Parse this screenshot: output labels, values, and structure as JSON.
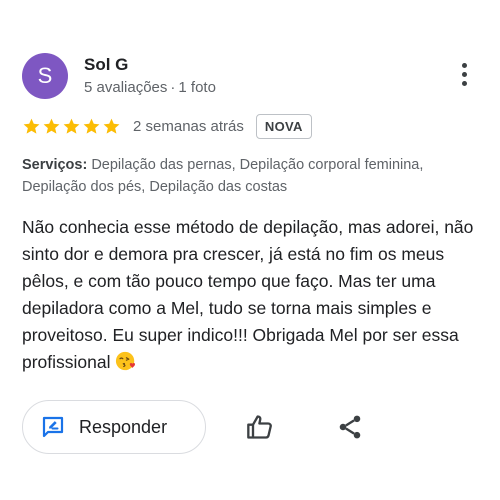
{
  "reviewer": {
    "initial": "S",
    "name": "Sol G",
    "reviews_count": "5 avaliações",
    "separator": "·",
    "photos_count": "1 foto",
    "avatar_color": "#7e57c2"
  },
  "rating": {
    "stars": 5,
    "max_stars": 5,
    "star_color": "#fbbc04",
    "time_ago": "2 semanas atrás",
    "badge": "NOVA"
  },
  "services": {
    "label": "Serviços:",
    "text": "Depilação das pernas, Depilação corporal feminina, Depilação dos pés, Depilação das costas"
  },
  "review": {
    "text": "Não conhecia esse método de depilação, mas adorei, não sinto dor e demora pra crescer, já está no fim os meus pêlos, e com tão pouco tempo que faço. Mas ter uma depiladora como a Mel, tudo se torna mais simples e proveitoso. Eu super indico!!! Obrigada Mel por ser essa profissional",
    "emoji": "face-blowing-kiss-emoji"
  },
  "actions": {
    "reply_label": "Responder",
    "reply_icon": "reply-edit-icon",
    "like_icon": "thumbs-up-icon",
    "share_icon": "share-icon",
    "accent": "#1a73e8"
  },
  "menu_icon": "more-vert-icon"
}
